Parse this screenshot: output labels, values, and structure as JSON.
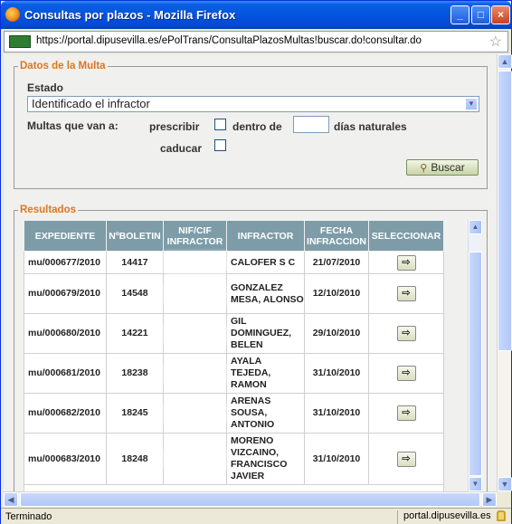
{
  "window": {
    "title": "Consultas por plazos - Mozilla Firefox",
    "min_glyph": "_",
    "max_glyph": "□",
    "close_glyph": "×"
  },
  "address_bar": {
    "url": "https://portal.dipusevilla.es/ePolTrans/ConsultaPlazosMultas!buscar.do!consultar.do",
    "star_glyph": "☆"
  },
  "filters": {
    "legend": "Datos de la Multa",
    "estado_label": "Estado",
    "estado_value": "Identificado el infractor",
    "multas_label": "Multas que van a:",
    "prescribir_label": "prescribir",
    "prescribir_checked": false,
    "dentro_de_label": "dentro de",
    "dias_value": "",
    "dias_label": "días naturales",
    "caducar_label": "caducar",
    "caducar_checked": false,
    "search_button": "Buscar"
  },
  "results": {
    "legend": "Resultados",
    "columns": [
      "EXPEDIENTE",
      "NºBOLETIN",
      "NIF/CIF INFRACTOR",
      "INFRACTOR",
      "FECHA INFRACCION",
      "SELECCIONAR"
    ],
    "rows": [
      {
        "expediente": "mu/000677/2010",
        "boletin": "14417",
        "nif": "",
        "infractor": "CALOFER S C",
        "fecha": "21/07/2010"
      },
      {
        "expediente": "mu/000679/2010",
        "boletin": "14548",
        "nif": "",
        "infractor": "GONZALEZ MESA, ALONSO",
        "fecha": "12/10/2010"
      },
      {
        "expediente": "mu/000680/2010",
        "boletin": "14221",
        "nif": "",
        "infractor": "GIL DOMINGUEZ, BELEN",
        "fecha": "29/10/2010"
      },
      {
        "expediente": "mu/000681/2010",
        "boletin": "18238",
        "nif": "",
        "infractor": "AYALA TEJEDA, RAMON",
        "fecha": "31/10/2010"
      },
      {
        "expediente": "mu/000682/2010",
        "boletin": "18245",
        "nif": "",
        "infractor": "ARENAS SOUSA, ANTONIO",
        "fecha": "31/10/2010"
      },
      {
        "expediente": "mu/000683/2010",
        "boletin": "18248",
        "nif": "",
        "infractor": "MORENO VIZCAINO, FRANCISCO JAVIER",
        "fecha": "31/10/2010"
      }
    ],
    "select_glyph": "⇨"
  },
  "status": {
    "left": "Terminado",
    "right": "portal.dipusevilla.es"
  },
  "colors": {
    "titlebar": "#0554e0",
    "legend": "#e0761b",
    "header": "#7d9ca8"
  },
  "icons": [
    "firefox-icon",
    "site-identity-icon",
    "bookmark-star-icon",
    "search-icon",
    "select-arrow-icon",
    "lock-icon"
  ]
}
